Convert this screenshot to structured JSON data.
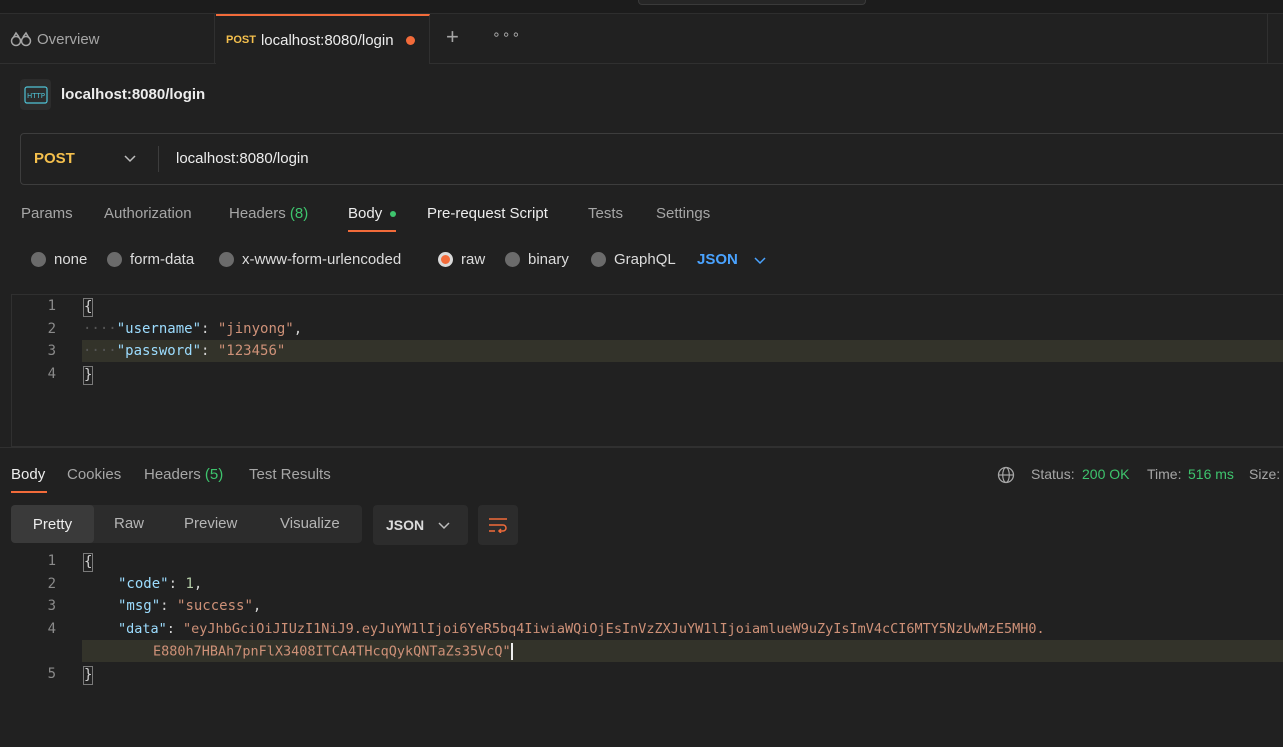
{
  "tabs": {
    "overview": "Overview",
    "active": {
      "method": "POST",
      "title": "localhost:8080/login"
    }
  },
  "request": {
    "icon": "HTTP",
    "name": "localhost:8080/login",
    "method": "POST",
    "url": "localhost:8080/login",
    "tabs": {
      "params": "Params",
      "authorization": "Authorization",
      "headers": "Headers",
      "headers_count": "(8)",
      "body": "Body",
      "pre_request": "Pre-request Script",
      "tests": "Tests",
      "settings": "Settings"
    },
    "body_types": {
      "none": "none",
      "form_data": "form-data",
      "urlencoded": "x-www-form-urlencoded",
      "raw": "raw",
      "binary": "binary",
      "graphql": "GraphQL",
      "selected": "raw",
      "format": "JSON"
    },
    "editor": {
      "line_numbers": [
        "1",
        "2",
        "3",
        "4"
      ],
      "open": "{",
      "close": "}",
      "k_username": "\"username\"",
      "v_username": "\"jinyong\"",
      "k_password": "\"password\"",
      "v_password": "\"123456\"",
      "indent": "····"
    }
  },
  "response": {
    "tabs": {
      "body": "Body",
      "cookies": "Cookies",
      "headers": "Headers",
      "headers_count": "(5)",
      "test_results": "Test Results"
    },
    "status_label": "Status:",
    "status_value": "200 OK",
    "time_label": "Time:",
    "time_value": "516 ms",
    "size_label": "Size:",
    "views": {
      "pretty": "Pretty",
      "raw": "Raw",
      "preview": "Preview",
      "visualize": "Visualize"
    },
    "format": "JSON",
    "editor": {
      "line_numbers": [
        "1",
        "2",
        "3",
        "4",
        "5"
      ],
      "open": "{",
      "close": "}",
      "k_code": "\"code\"",
      "v_code": "1",
      "k_msg": "\"msg\"",
      "v_msg": "\"success\"",
      "k_data": "\"data\"",
      "v_data_1": "\"eyJhbGciOiJIUzI1NiJ9.eyJuYW1lIjoi6YeR5bq4IiwiaWQiOjEsInVzZXJuYW1lIjoiamlueW9uZyIsImV4cCI6MTY5NzUwMzE5MH0.",
      "v_data_2": "E880h7HBAh7pnFlX3408ITCA4THcqQykQNTaZs35VcQ\""
    }
  }
}
